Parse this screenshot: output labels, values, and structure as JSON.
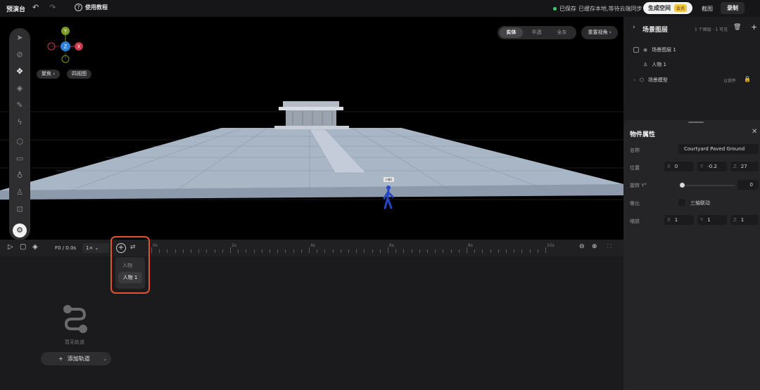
{
  "topbar": {
    "title": "预演台",
    "help_label": "使用教程",
    "saved_label": "已保存",
    "sync_status": "已缓存本地,等待云端同步",
    "generate_label": "生成空间",
    "generate_badge": "会员",
    "preview_label": "截图",
    "record_label": "录制",
    "saved_dot_color": "#3ccf6e"
  },
  "viewport": {
    "focus_chip": "聚焦",
    "view_chip": "四视图",
    "modes": [
      "实体",
      "半透",
      "全灰"
    ],
    "active_mode": "实体",
    "reset_view": "重置视角",
    "gizmo": {
      "y": "Y",
      "z": "Z",
      "x": "X"
    },
    "person_tag": "人物1"
  },
  "scene_layers": {
    "title": "场景图层",
    "count_text": "1 个图层 · 1 可见",
    "rows": [
      {
        "label": "场景图层 1"
      },
      {
        "label": "人物 1"
      },
      {
        "label": "场景模型",
        "status": "以锁件"
      }
    ]
  },
  "properties": {
    "title": "物件属性",
    "name_label": "名称",
    "name_value": "Courtyard Paved Ground",
    "position_label": "位置",
    "position": {
      "x": "0",
      "y": "-0.2",
      "z": "27"
    },
    "rotation_label": "旋转 Y°",
    "rotation_value": "0",
    "rotation_fraction": 0,
    "ratio_label": "等比",
    "ratio_toggle_label": "三轴联动",
    "scale_label": "缩放",
    "scale": {
      "x": "1",
      "y": "1",
      "z": "1"
    }
  },
  "timeline": {
    "frame_text": "F0 / 0.0s",
    "speed": "1×",
    "ruler": [
      "0s",
      "2s",
      "4s",
      "6s",
      "8s",
      "10s"
    ],
    "popup_category": "人物",
    "popup_item": "人物 1",
    "empty_label": "暂无轨道",
    "add_track_label": "添加轨道"
  },
  "colors": {
    "accent_highlight": "#e0532d",
    "axis_y": "#7a9a25",
    "axis_z": "#2f7fd8",
    "axis_x": "#c8394a"
  }
}
